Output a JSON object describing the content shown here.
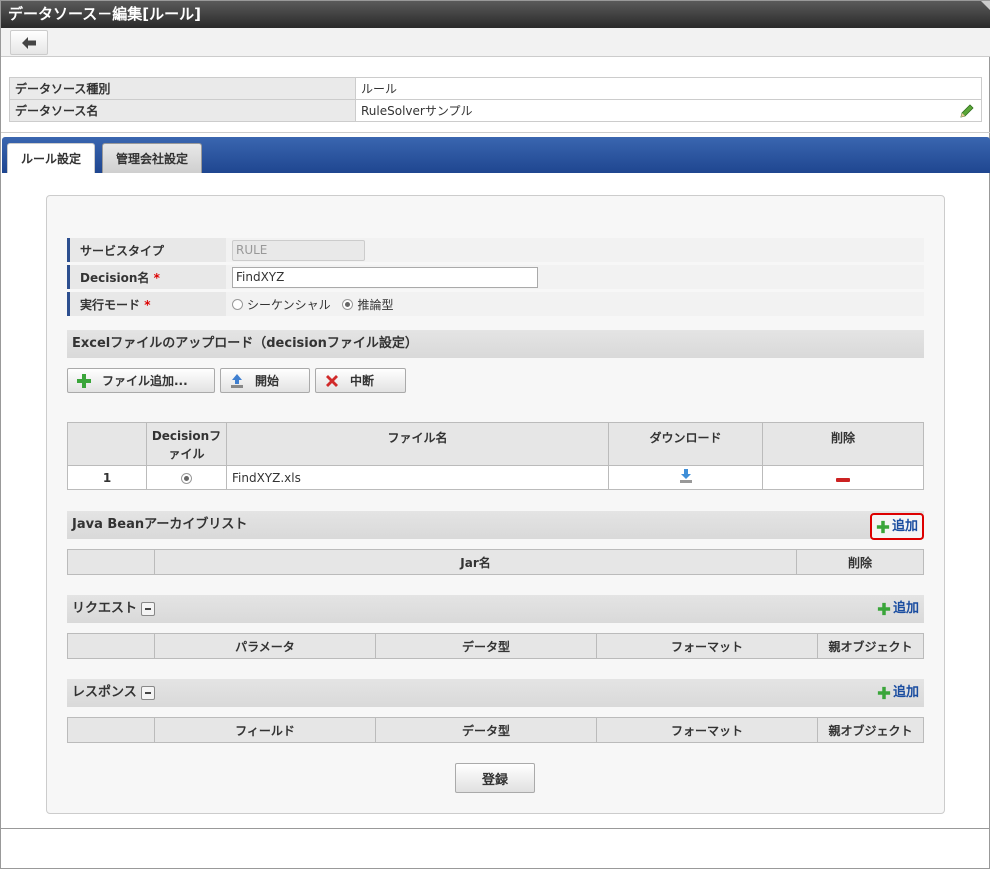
{
  "window": {
    "title": "データソース－編集[ルール]"
  },
  "info": {
    "rows": [
      {
        "label": "データソース種別",
        "value": "ルール"
      },
      {
        "label": "データソース名",
        "value": "RuleSolverサンプル"
      }
    ]
  },
  "tabs": [
    {
      "label": "ルール設定",
      "active": true
    },
    {
      "label": "管理会社設定",
      "active": false
    }
  ],
  "form": {
    "service_type": {
      "label": "サービスタイプ",
      "value": "RULE"
    },
    "decision_name": {
      "label": "Decision名",
      "required_mark": "*",
      "value": "FindXYZ"
    },
    "exec_mode": {
      "label": "実行モード",
      "required_mark": "*",
      "options": [
        "シーケンシャル",
        "推論型"
      ],
      "selected": "推論型"
    }
  },
  "excel_section": {
    "title": "Excelファイルのアップロード（decisionファイル設定）",
    "buttons": {
      "add": "ファイル追加...",
      "start": "開始",
      "stop": "中断"
    },
    "columns": {
      "no": "",
      "decision": "Decisionファイル",
      "filename": "ファイル名",
      "download": "ダウンロード",
      "delete": "削除"
    },
    "rows": [
      {
        "no": "1",
        "filename": "FindXYZ.xls"
      }
    ]
  },
  "javabean_section": {
    "title": "Java Beanアーカイブリスト",
    "add_label": "追加",
    "columns": {
      "blank": "",
      "jar": "Jar名",
      "delete": "削除"
    }
  },
  "request_section": {
    "title": "リクエスト",
    "add_label": "追加",
    "columns": {
      "blank": "",
      "param": "パラメータ",
      "type": "データ型",
      "format": "フォーマット",
      "parent": "親オブジェクト"
    }
  },
  "response_section": {
    "title": "レスポンス",
    "add_label": "追加",
    "columns": {
      "blank": "",
      "field": "フィールド",
      "type": "データ型",
      "format": "フォーマット",
      "parent": "親オブジェクト"
    }
  },
  "submit_label": "登録",
  "colors": {
    "tab_bar": "#2a549f",
    "required": "#dd0000",
    "link": "#1a4da0",
    "highlight_border": "#dd0000",
    "add_icon": "#3aa53a",
    "delete_icon": "#cc2222"
  }
}
